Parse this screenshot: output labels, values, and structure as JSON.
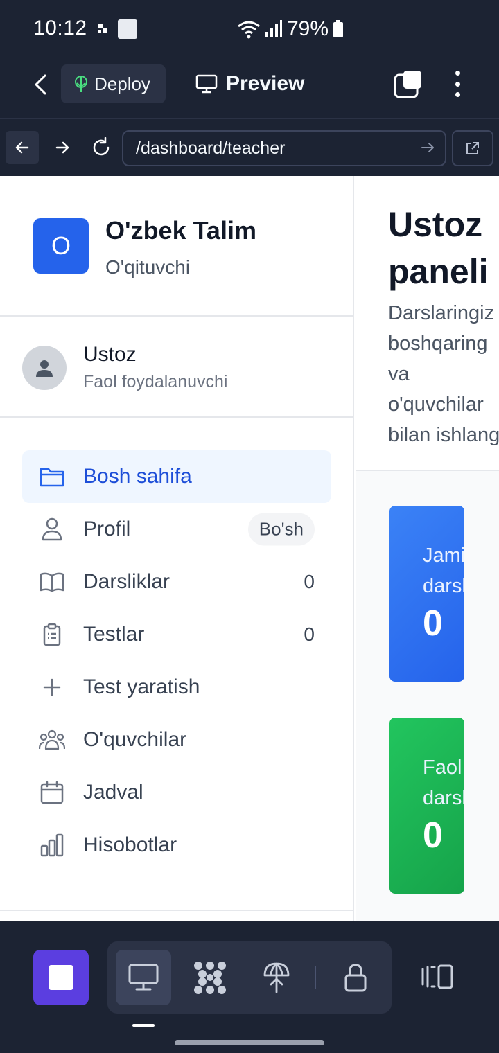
{
  "status_bar": {
    "time": "10:12",
    "battery": "79%"
  },
  "topbar": {
    "deploy_label": "Deploy",
    "preview_label": "Preview"
  },
  "urlbar": {
    "url": "/dashboard/teacher"
  },
  "sidebar": {
    "brand": {
      "logo_letter": "O",
      "name": "O'zbek Talim",
      "role": "O'qituvchi"
    },
    "user": {
      "name": "Ustoz",
      "status": "Faol foydalanuvchi"
    },
    "nav": [
      {
        "label": "Bosh sahifa",
        "icon": "folder-icon",
        "active": true
      },
      {
        "label": "Profil",
        "icon": "user-icon",
        "badge": "Bo'sh"
      },
      {
        "label": "Darsliklar",
        "icon": "book-icon",
        "count": "0"
      },
      {
        "label": "Testlar",
        "icon": "clipboard-icon",
        "count": "0"
      },
      {
        "label": "Test yaratish",
        "icon": "plus-icon"
      },
      {
        "label": "O'quvchilar",
        "icon": "users-icon"
      },
      {
        "label": "Jadval",
        "icon": "calendar-icon"
      },
      {
        "label": "Hisobotlar",
        "icon": "bar-chart-icon"
      }
    ]
  },
  "main": {
    "title_line1": "Ustoz",
    "title_line2": "paneli",
    "subtitle_lines": [
      "Darslaringiz",
      "boshqaring",
      "va",
      "o'quvchilar",
      "bilan ishlang"
    ],
    "stats": [
      {
        "label_line1": "Jami",
        "label_line2": "darsliklar",
        "value": "0",
        "color": "#2563eb"
      },
      {
        "label_line1": "Faol",
        "label_line2": "darsliklar",
        "value": "0",
        "color": "#16a34a"
      }
    ]
  },
  "colors": {
    "chrome": "#1c2333",
    "accent_blue": "#2563eb",
    "run_purple": "#5b3ee0"
  }
}
